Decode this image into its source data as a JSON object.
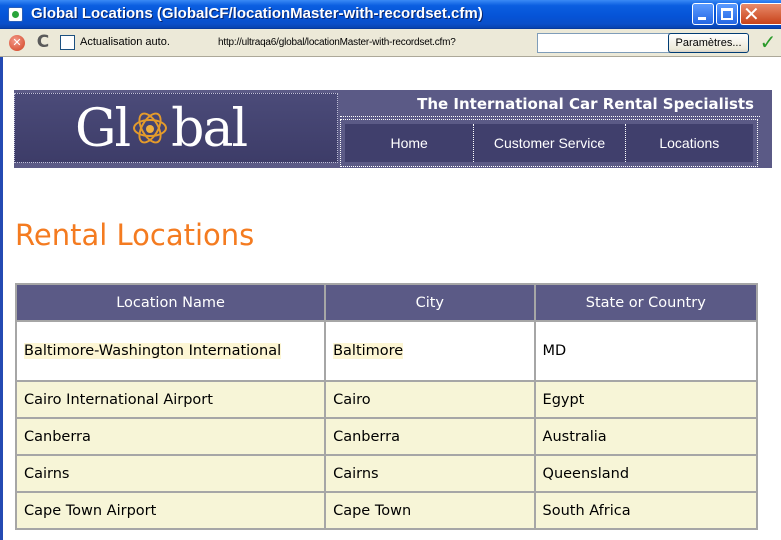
{
  "window": {
    "title": "Global Locations (GlobalCF/locationMaster-with-recordset.cfm)"
  },
  "toolbar": {
    "auto_refresh_label": "Actualisation auto.",
    "auto_refresh_checked": false,
    "url": "http://ultraqa6/global/locationMaster-with-recordset.cfm?",
    "url_combo_value": "",
    "params_label": "Paramètres..."
  },
  "site": {
    "logo_text_before": "Gl",
    "logo_text_after": "bal",
    "tagline": "The International Car Rental Specialists",
    "nav": [
      {
        "label": "Home"
      },
      {
        "label": "Customer Service"
      },
      {
        "label": "Locations"
      }
    ]
  },
  "page": {
    "heading": "Rental Locations",
    "heading_color": "#f47b20"
  },
  "table": {
    "headers": [
      "Location Name",
      "City",
      "State or Country"
    ],
    "rows": [
      [
        "Baltimore-Washington International",
        "Baltimore",
        "MD"
      ],
      [
        "Cairo International Airport",
        "Cairo",
        "Egypt"
      ],
      [
        "Canberra",
        "Canberra",
        "Australia"
      ],
      [
        "Cairns",
        "Cairns",
        "Queensland"
      ],
      [
        "Cape Town Airport",
        "Cape Town",
        "South Africa"
      ]
    ]
  },
  "colors": {
    "title_bar": "#0553d6",
    "header_band": "#5b5a86",
    "nav_button": "#403f6c",
    "row_fill": "#f7f5d7"
  },
  "icons": {
    "app": "document-icon",
    "stop": "stop-icon",
    "refresh": "refresh-icon",
    "go": "go-icon",
    "minimize": "minimize-icon",
    "maximize": "maximize-icon",
    "close": "close-icon",
    "logo_symbol": "atom-icon"
  }
}
